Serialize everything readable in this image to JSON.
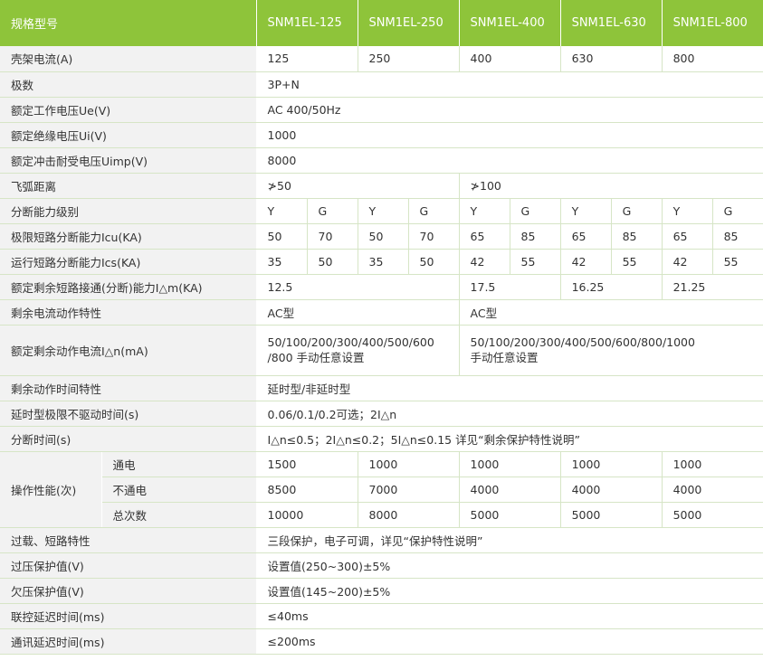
{
  "header": {
    "label": "规格型号",
    "models": [
      "SNM1EL-125",
      "SNM1EL-250",
      "SNM1EL-400",
      "SNM1EL-630",
      "SNM1EL-800"
    ]
  },
  "rows": {
    "frame_current": {
      "label": "壳架电流(A)",
      "values": [
        "125",
        "250",
        "400",
        "630",
        "800"
      ]
    },
    "poles": {
      "label": "极数",
      "value": "3P+N"
    },
    "rated_voltage": {
      "label": "额定工作电压Ue(V)",
      "value": "AC 400/50Hz"
    },
    "insulation_voltage": {
      "label": "额定绝缘电压Ui(V)",
      "value": "1000"
    },
    "impulse_voltage": {
      "label": "额定冲击耐受电压Uimp(V)",
      "value": "8000"
    },
    "arc_distance": {
      "label": "飞弧距离",
      "values": [
        "≯50",
        "≯100"
      ]
    },
    "breaking_class": {
      "label": "分断能力级别",
      "values": [
        "Y",
        "G",
        "Y",
        "G",
        "Y",
        "G",
        "Y",
        "G",
        "Y",
        "G"
      ]
    },
    "icu": {
      "label": "极限短路分断能力Icu(KA)",
      "values": [
        "50",
        "70",
        "50",
        "70",
        "65",
        "85",
        "65",
        "85",
        "65",
        "85"
      ]
    },
    "ics": {
      "label": "运行短路分断能力Ics(KA)",
      "values": [
        "35",
        "50",
        "35",
        "50",
        "42",
        "55",
        "42",
        "55",
        "42",
        "55"
      ]
    },
    "residual_make_break": {
      "label": "额定剩余短路接通(分断)能力I△m(KA)",
      "values": [
        "12.5",
        "17.5",
        "16.25",
        "21.25"
      ]
    },
    "residual_action": {
      "label": "剩余电流动作特性",
      "values": [
        "AC型",
        "AC型"
      ]
    },
    "residual_current": {
      "label": "额定剩余动作电流I△n(mA)",
      "values": [
        "50/100/200/300/400/500/600\n/800 手动任意设置",
        "50/100/200/300/400/500/600/800/1000\n手动任意设置"
      ]
    },
    "residual_time": {
      "label": "剩余动作时间特性",
      "value": "延时型/非延时型"
    },
    "delay_no_trip": {
      "label": "延时型极限不驱动时间(s)",
      "value": "0.06/0.1/0.2可选；2I△n"
    },
    "break_time": {
      "label": "分断时间(s)",
      "value": "I△n≤0.5；2I△n≤0.2；5I△n≤0.15 详见“剩余保护特性说明”"
    },
    "operation": {
      "label": "操作性能(次)",
      "powered": {
        "label": "通电",
        "values": [
          "1500",
          "1000",
          "1000",
          "1000",
          "1000"
        ]
      },
      "unpowered": {
        "label": "不通电",
        "values": [
          "8500",
          "7000",
          "4000",
          "4000",
          "4000"
        ]
      },
      "total": {
        "label": "总次数",
        "values": [
          "10000",
          "8000",
          "5000",
          "5000",
          "5000"
        ]
      }
    },
    "overload": {
      "label": "过载、短路特性",
      "value": "三段保护，电子可调，详见“保护特性说明”"
    },
    "overvoltage": {
      "label": "过压保护值(V)",
      "value": "设置值(250~300)±5%"
    },
    "undervoltage": {
      "label": "欠压保护值(V)",
      "value": "设置值(145~200)±5%"
    },
    "interlock_delay": {
      "label": "联控延迟时间(ms)",
      "value": "≤40ms"
    },
    "comm_delay": {
      "label": "通讯延迟时间(ms)",
      "value": "≤200ms"
    }
  },
  "colors": {
    "header_bg": "#8ec43a",
    "label_bg": "#f2f2f2",
    "grid_line": "#d6e5c6",
    "text": "#333333"
  }
}
